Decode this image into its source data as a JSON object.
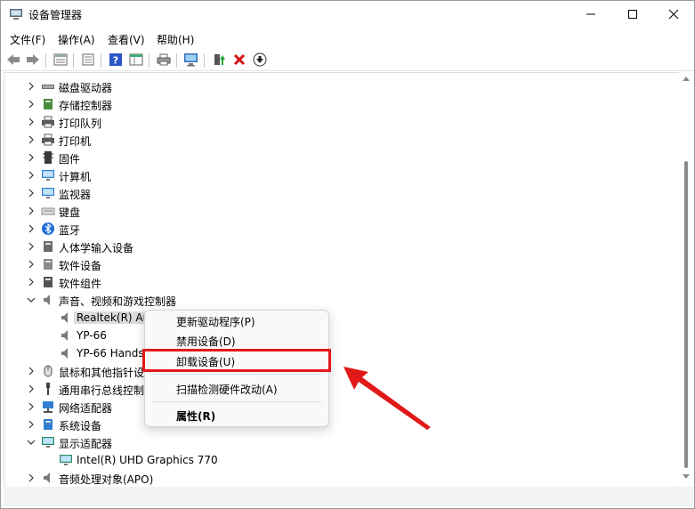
{
  "window": {
    "title": "设备管理器"
  },
  "menu": [
    "文件(F)",
    "操作(A)",
    "查看(V)",
    "帮助(H)"
  ],
  "tree": [
    {
      "label": "磁盘驱动器",
      "icon": "disk-drive-icon",
      "expanded": false
    },
    {
      "label": "存储控制器",
      "icon": "storage-controller-icon",
      "expanded": false
    },
    {
      "label": "打印队列",
      "icon": "print-queue-icon",
      "expanded": false
    },
    {
      "label": "打印机",
      "icon": "printer-icon",
      "expanded": false
    },
    {
      "label": "固件",
      "icon": "firmware-icon",
      "expanded": false
    },
    {
      "label": "计算机",
      "icon": "computer-icon",
      "expanded": false
    },
    {
      "label": "监视器",
      "icon": "monitor-icon",
      "expanded": false
    },
    {
      "label": "键盘",
      "icon": "keyboard-icon",
      "expanded": false
    },
    {
      "label": "蓝牙",
      "icon": "bluetooth-icon",
      "expanded": false
    },
    {
      "label": "人体学输入设备",
      "icon": "hid-icon",
      "expanded": false
    },
    {
      "label": "软件设备",
      "icon": "software-device-icon",
      "expanded": false
    },
    {
      "label": "软件组件",
      "icon": "software-component-icon",
      "expanded": false
    },
    {
      "label": "声音、视频和游戏控制器",
      "icon": "speaker-icon",
      "expanded": true
    },
    {
      "label": "Realtek(R) Au",
      "icon": "speaker-icon",
      "child": true,
      "selected": true
    },
    {
      "label": "YP-66",
      "icon": "speaker-icon",
      "child": true
    },
    {
      "label": "YP-66 Hands-",
      "icon": "speaker-icon",
      "child": true
    },
    {
      "label": "鼠标和其他指针设",
      "icon": "mouse-icon",
      "expanded": false
    },
    {
      "label": "通用串行总线控制",
      "icon": "usb-icon",
      "expanded": false
    },
    {
      "label": "网络适配器",
      "icon": "network-icon",
      "expanded": false
    },
    {
      "label": "系统设备",
      "icon": "system-device-icon",
      "expanded": false
    },
    {
      "label": "显示适配器",
      "icon": "display-adapter-icon",
      "expanded": true
    },
    {
      "label": "Intel(R) UHD Graphics 770",
      "icon": "display-adapter-icon",
      "child": true
    },
    {
      "label": "音频处理对象(APO)",
      "icon": "speaker-icon",
      "expanded": false
    }
  ],
  "context_menu": {
    "update_driver": "更新驱动程序(P)",
    "disable_device": "禁用设备(D)",
    "uninstall_device": "卸载设备(U)",
    "scan_hardware": "扫描检测硬件改动(A)",
    "properties": "属性(R)"
  },
  "colors": {
    "highlight": "#e11919",
    "selection": "#dcdcdc"
  }
}
